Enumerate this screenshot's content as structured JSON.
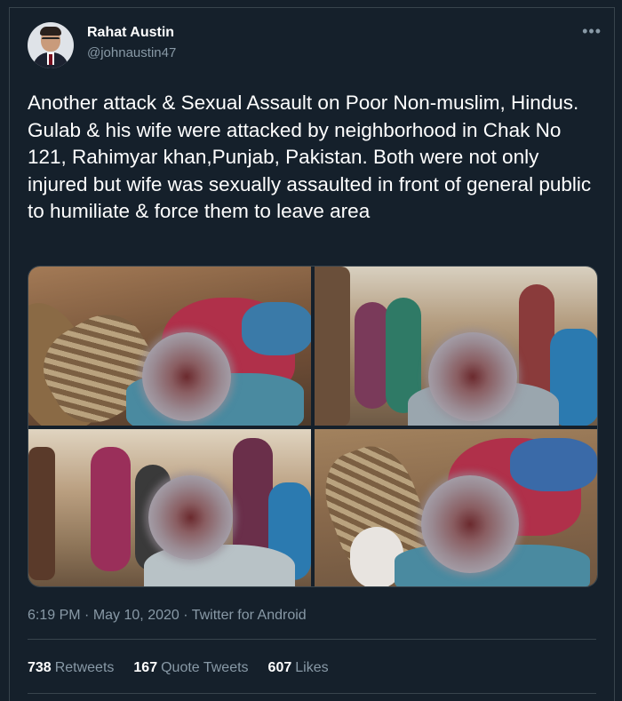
{
  "author": {
    "name": "Rahat Austin",
    "handle": "@johnaustin47"
  },
  "tweet": {
    "text": "Another attack & Sexual Assault on Poor Non-muslim, Hindus. Gulab & his wife were attacked by neighborhood in Chak No 121, Rahimyar khan,Punjab, Pakistan. Both were not only injured but wife was sexually assaulted in front of general public to humiliate & force them to leave area",
    "time": "6:19 PM",
    "date": "May 10, 2020",
    "source": "Twitter for Android"
  },
  "stats": {
    "retweets_count": "738",
    "retweets_label": "Retweets",
    "quotes_count": "167",
    "quotes_label": "Quote Tweets",
    "likes_count": "607",
    "likes_label": "Likes"
  },
  "icons": {
    "more": "more-options-icon"
  },
  "colors": {
    "background": "#15202b",
    "secondary_text": "#8899a6",
    "border": "#38444d"
  }
}
